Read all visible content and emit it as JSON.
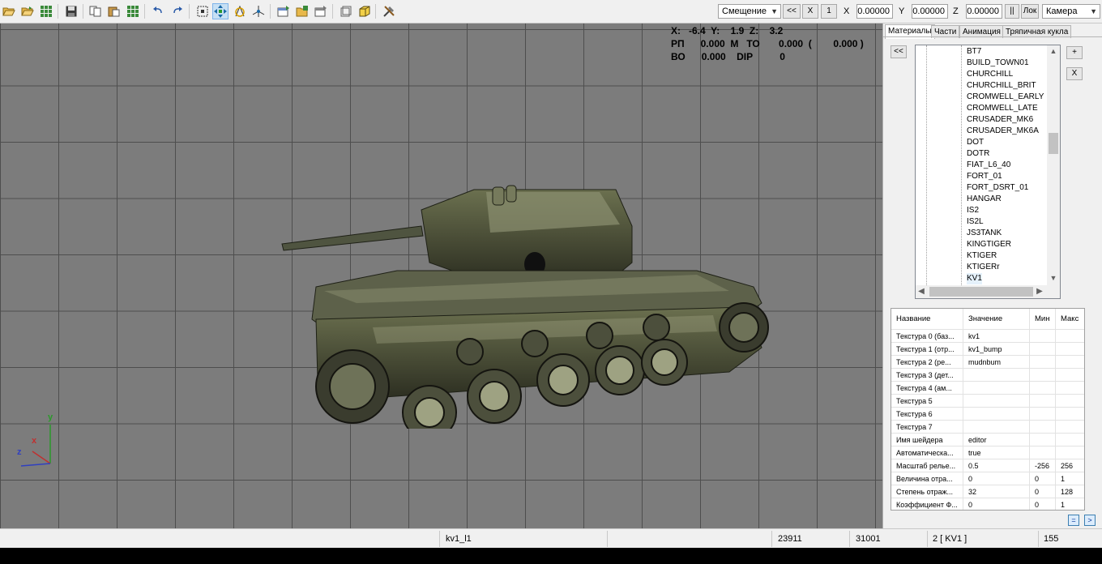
{
  "toolbar": {
    "icons": [
      "open-folder-icon",
      "open-file-icon",
      "grid-icon",
      "save-icon",
      "copy-icon",
      "paste-icon",
      "grid-select-icon",
      "undo-icon",
      "redo-icon",
      "select-icon",
      "move-icon",
      "rotate-icon",
      "scale-icon",
      "properties-icon",
      "folder-properties-icon",
      "settings-icon",
      "frame-icon",
      "cube-icon",
      "tools-icon"
    ],
    "mode_select": "Смещение",
    "back_label": "<<",
    "x_button": "X",
    "one_button": "1",
    "x_label": "X",
    "x_value": "0.00000",
    "y_label": "Y",
    "y_value": "0.00000",
    "z_label": "Z",
    "z_value": "0.00000",
    "pause_label": "||",
    "lock_label": "Лок",
    "camera_select": "Камера"
  },
  "hud": {
    "line1": "X:   -6.4  Y:    1.9  Z:    3.2",
    "line2": "РП      0.000  М   ТО       0.000  (        0.000 )",
    "line3": "ВО      0.000    DIP          0"
  },
  "axis": {
    "y": "y",
    "x": "x",
    "z": "z"
  },
  "panel": {
    "tabs": [
      "Материалы",
      "Части",
      "Анимация",
      "Тряпичная кукла"
    ],
    "collapse_label": "<<",
    "add_label": "+",
    "remove_label": "X",
    "tree_items": [
      "BT7",
      "BUILD_TOWN01",
      "CHURCHILL",
      "CHURCHILL_BRIT",
      "CROMWELL_EARLY",
      "CROMWELL_LATE",
      "CRUSADER_MK6",
      "CRUSADER_MK6A",
      "DOT",
      "DOTR",
      "FIAT_L6_40",
      "FORT_01",
      "FORT_DSRT_01",
      "HANGAR",
      "IS2",
      "IS2L",
      "JS3TANK",
      "KINGTIGER",
      "KTIGER",
      "KTIGERr",
      "KV1"
    ],
    "selected_item": "KV1",
    "grid_headers": [
      "Название",
      "Значение",
      "Мин",
      "Макс"
    ],
    "grid_rows": [
      [
        "Текстура 0 (баз...",
        "kv1",
        "",
        ""
      ],
      [
        "Текстура 1 (отр...",
        "kv1_bump",
        "",
        ""
      ],
      [
        "Текстура 2 (ре...",
        "mudnbum",
        "",
        ""
      ],
      [
        "Текстура 3 (дет...",
        "",
        "",
        ""
      ],
      [
        "Текстура 4 (ам...",
        "",
        "",
        ""
      ],
      [
        "Текстура 5",
        "",
        "",
        ""
      ],
      [
        "Текстура 6",
        "",
        "",
        ""
      ],
      [
        "Текстура 7",
        "",
        "",
        ""
      ],
      [
        "Имя шейдера",
        "editor",
        "",
        ""
      ],
      [
        "Автоматическа...",
        "true",
        "",
        ""
      ],
      [
        "Масштаб релье...",
        "0.5",
        "-256",
        "256"
      ],
      [
        "Величина отра...",
        "0",
        "0",
        "1"
      ],
      [
        "Степень отраж...",
        "32",
        "0",
        "128"
      ],
      [
        "Коэффициент Ф...",
        "0",
        "0",
        "1"
      ]
    ],
    "eq_button": "=",
    "next_button": ">"
  },
  "status": {
    "file": "kv1_l1",
    "v1": "23911",
    "v2": "31001",
    "v3": "2 [ KV1 ]",
    "v4": "155"
  }
}
